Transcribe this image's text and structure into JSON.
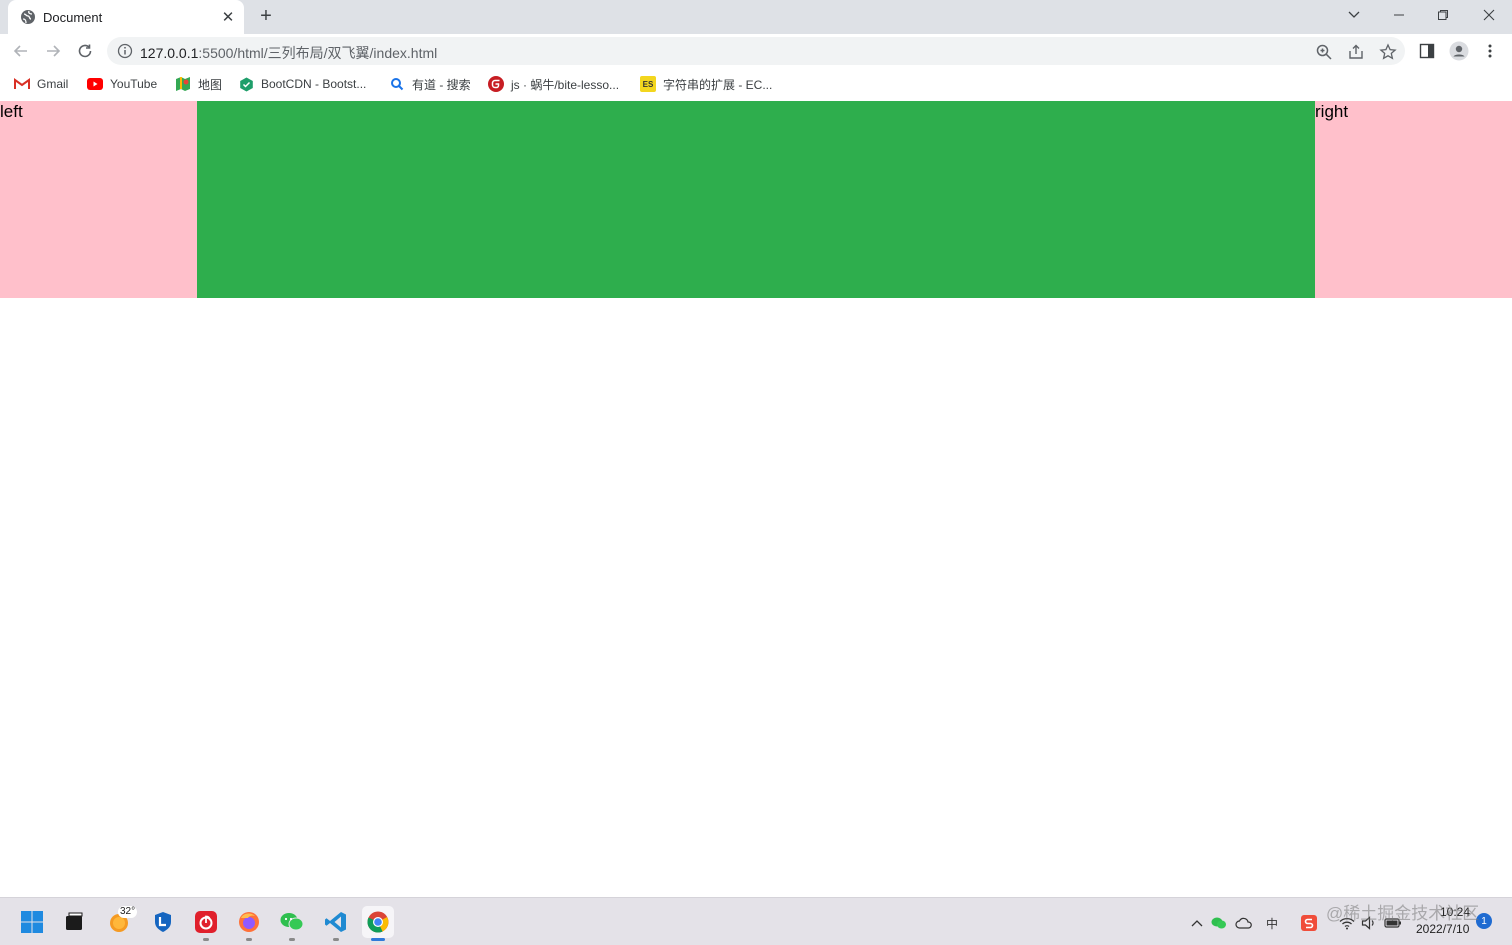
{
  "browser": {
    "tab": {
      "title": "Document",
      "close_glyph": "✕"
    },
    "new_tab_glyph": "+",
    "window_controls": [
      "chevron-down-icon",
      "minimize-icon",
      "restore-icon",
      "close-icon"
    ],
    "address": {
      "host": "127.0.0.1",
      "path": ":5500/html/三列布局/双飞翼/index.html"
    },
    "bookmarks": [
      {
        "label": "Gmail",
        "icon": "gmail-icon"
      },
      {
        "label": "YouTube",
        "icon": "youtube-icon"
      },
      {
        "label": "地图",
        "icon": "maps-icon"
      },
      {
        "label": "BootCDN - Bootst...",
        "icon": "bootcdn-icon"
      },
      {
        "label": "有道 - 搜索",
        "icon": "search-icon"
      },
      {
        "label": "js · 蜗牛/bite-lesso...",
        "icon": "gitee-icon"
      },
      {
        "label": "字符串的扩展 - EC...",
        "icon": "es-icon"
      }
    ],
    "es_badge": "ES"
  },
  "page": {
    "left_label": "left",
    "center_label": "",
    "right_label": "right",
    "colors": {
      "side": "#ffc0cb",
      "center": "#2eae4d"
    }
  },
  "taskbar": {
    "weather_temp": "32°",
    "ime_label": "中",
    "time": "10:24",
    "date": "2022/7/10",
    "notification_count": "1",
    "watermark": "@稀土掘金技术社区"
  }
}
